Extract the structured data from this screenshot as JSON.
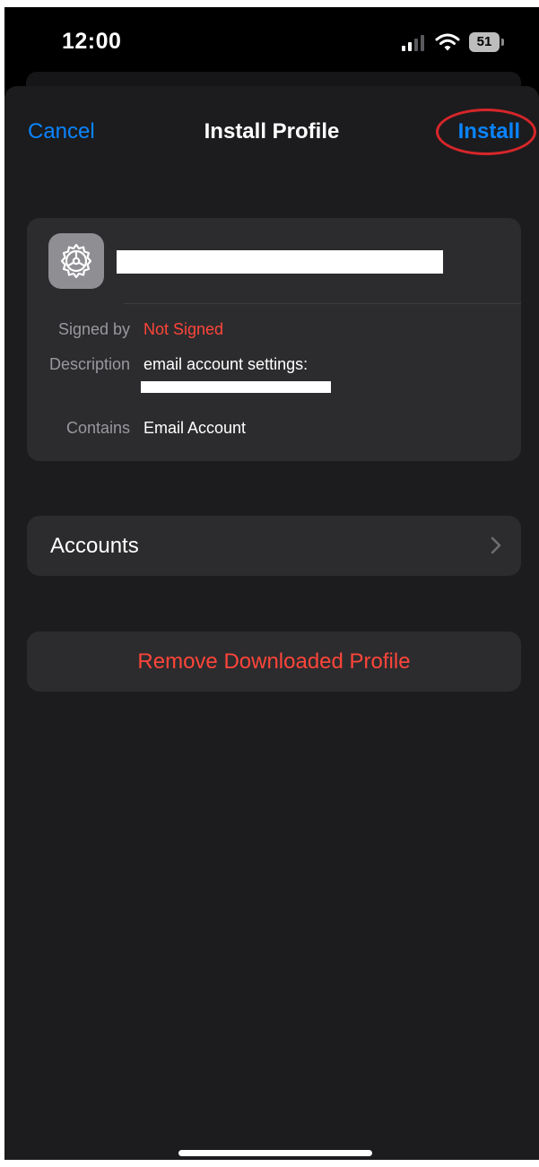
{
  "status_bar": {
    "time": "12:00",
    "battery_level": "51",
    "icons": [
      "signal-bars-icon",
      "wifi-icon",
      "battery-icon"
    ]
  },
  "nav": {
    "cancel_label": "Cancel",
    "title": "Install Profile",
    "install_label": "Install"
  },
  "profile": {
    "app_icon": "settings-gear-icon",
    "details": [
      {
        "label": "Signed by",
        "value": "Not Signed"
      },
      {
        "label": "Description",
        "value": "email account settings:"
      },
      {
        "label": "Contains",
        "value": "Email Account"
      }
    ]
  },
  "accounts": {
    "label": "Accounts",
    "icon": "chevron-right-icon"
  },
  "remove": {
    "label": "Remove Downloaded Profile"
  },
  "colors": {
    "accent_blue": "#0a84ff",
    "destructive_red": "#ff453a",
    "annotation_red": "#d6262a",
    "sheet_background": "#1c1c1e",
    "card_background": "#2c2c2e"
  }
}
